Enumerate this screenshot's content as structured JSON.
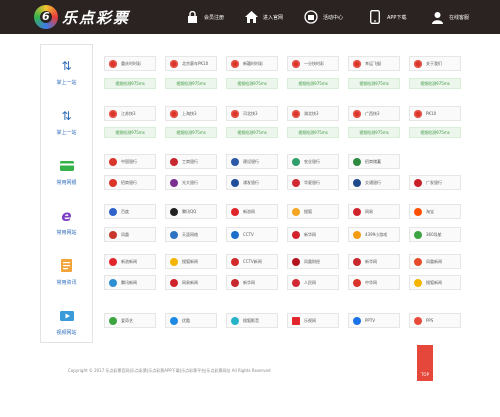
{
  "header": {
    "logo_glyph": "6",
    "logo_text": "乐点彩票",
    "nav": [
      {
        "icon": "lock-icon",
        "label": "会员注册"
      },
      {
        "icon": "home-icon",
        "label": "进入官网"
      },
      {
        "icon": "gift-icon",
        "label": "活动中心"
      },
      {
        "icon": "phone-icon",
        "label": "APP下载"
      },
      {
        "icon": "support-icon",
        "label": "在线客服"
      }
    ]
  },
  "sidebar": {
    "items": [
      {
        "icon": "swap-icon",
        "label": "掌上一站"
      },
      {
        "icon": "swap-icon",
        "label": "掌上一站"
      },
      {
        "icon": "card-icon",
        "label": "常用网银"
      },
      {
        "icon": "ie-icon",
        "label": "常用网站"
      },
      {
        "icon": "doc-icon",
        "label": "常用资讯"
      },
      {
        "icon": "video-icon",
        "label": "视频网站"
      }
    ]
  },
  "grid": {
    "row1": {
      "labels": [
        "重庆时时彩",
        "北京赛车PK10",
        "新疆时时彩",
        "一分快时彩",
        "幸运飞艇",
        "关于我们"
      ],
      "badge": "视频检测975ms"
    },
    "row2": {
      "labels": [
        "江苏快3",
        "上海快3",
        "河北快3",
        "湖北快3",
        "广西快3",
        "PK10"
      ],
      "badge": "视频检测975ms"
    },
    "banks1": [
      "中国银行",
      "工商银行",
      "建设银行",
      "农业银行",
      "招商储蓄",
      ""
    ],
    "banks2": [
      "招商银行",
      "光大银行",
      "浦发银行",
      "华夏银行",
      "交通银行",
      "广发银行"
    ],
    "sites1": [
      "百度",
      "腾讯QQ",
      "新浪网",
      "搜狐",
      "网易",
      "淘宝"
    ],
    "sites2": [
      "凤凰",
      "天涯网络",
      "CCTV",
      "新华网",
      "4399小游戏",
      "360导航"
    ],
    "news1": [
      "新浪新闻",
      "搜狐新闻",
      "CCTV新闻",
      "凤凰财经",
      "新华网",
      "凤凰新闻"
    ],
    "news2": [
      "腾讯新闻",
      "网易新闻",
      "新华网",
      "人民网",
      "中华网",
      "搜狐新闻"
    ],
    "video1": [
      "爱奇艺",
      "优酷",
      "搜狐影音",
      "乐视网",
      "PPTV",
      "PPS"
    ]
  },
  "footer": {
    "copyright": "Copyright © 2017 乐点彩票官网|乐点彩票|乐点彩票APP下载|乐点彩票平台|乐点彩票网址 All Rights Reserved",
    "button": "TOP"
  }
}
